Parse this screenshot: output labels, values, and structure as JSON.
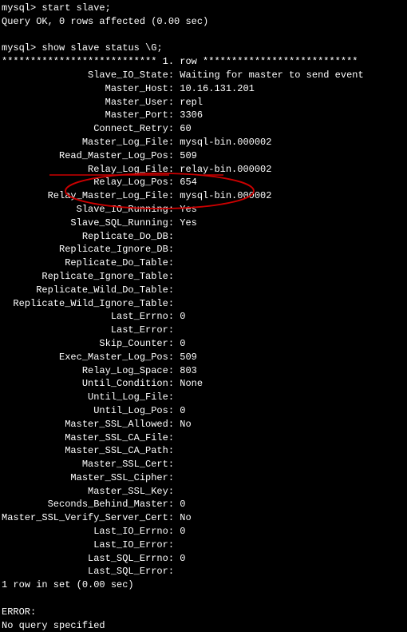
{
  "prompt": "mysql> ",
  "commands": {
    "start_slave": "start slave;",
    "start_slave_result": "Query OK, 0 rows affected (0.00 sec)",
    "show_slave": "show slave status \\G;"
  },
  "row_header": "*************************** 1. row ***************************",
  "fields": [
    {
      "label": "Slave_IO_State",
      "value": "Waiting for master to send event"
    },
    {
      "label": "Master_Host",
      "value": "10.16.131.201"
    },
    {
      "label": "Master_User",
      "value": "repl"
    },
    {
      "label": "Master_Port",
      "value": "3306"
    },
    {
      "label": "Connect_Retry",
      "value": "60"
    },
    {
      "label": "Master_Log_File",
      "value": "mysql-bin.000002"
    },
    {
      "label": "Read_Master_Log_Pos",
      "value": "509"
    },
    {
      "label": "Relay_Log_File",
      "value": "relay-bin.000002"
    },
    {
      "label": "Relay_Log_Pos",
      "value": "654"
    },
    {
      "label": "Relay_Master_Log_File",
      "value": "mysql-bin.000002"
    },
    {
      "label": "Slave_IO_Running",
      "value": "Yes"
    },
    {
      "label": "Slave_SQL_Running",
      "value": "Yes"
    },
    {
      "label": "Replicate_Do_DB",
      "value": ""
    },
    {
      "label": "Replicate_Ignore_DB",
      "value": ""
    },
    {
      "label": "Replicate_Do_Table",
      "value": ""
    },
    {
      "label": "Replicate_Ignore_Table",
      "value": ""
    },
    {
      "label": "Replicate_Wild_Do_Table",
      "value": ""
    },
    {
      "label": "Replicate_Wild_Ignore_Table",
      "value": ""
    },
    {
      "label": "Last_Errno",
      "value": "0"
    },
    {
      "label": "Last_Error",
      "value": ""
    },
    {
      "label": "Skip_Counter",
      "value": "0"
    },
    {
      "label": "Exec_Master_Log_Pos",
      "value": "509"
    },
    {
      "label": "Relay_Log_Space",
      "value": "803"
    },
    {
      "label": "Until_Condition",
      "value": "None"
    },
    {
      "label": "Until_Log_File",
      "value": ""
    },
    {
      "label": "Until_Log_Pos",
      "value": "0"
    },
    {
      "label": "Master_SSL_Allowed",
      "value": "No"
    },
    {
      "label": "Master_SSL_CA_File",
      "value": ""
    },
    {
      "label": "Master_SSL_CA_Path",
      "value": ""
    },
    {
      "label": "Master_SSL_Cert",
      "value": ""
    },
    {
      "label": "Master_SSL_Cipher",
      "value": ""
    },
    {
      "label": "Master_SSL_Key",
      "value": ""
    },
    {
      "label": "Seconds_Behind_Master",
      "value": "0"
    },
    {
      "label": "Master_SSL_Verify_Server_Cert",
      "value": "No"
    },
    {
      "label": "Last_IO_Errno",
      "value": "0"
    },
    {
      "label": "Last_IO_Error",
      "value": ""
    },
    {
      "label": "Last_SQL_Errno",
      "value": "0"
    },
    {
      "label": "Last_SQL_Error",
      "value": ""
    }
  ],
  "footer": {
    "row_count": "1 row in set (0.00 sec)",
    "error_label": "ERROR:",
    "error_msg": "No query specified"
  },
  "label_width": 29
}
